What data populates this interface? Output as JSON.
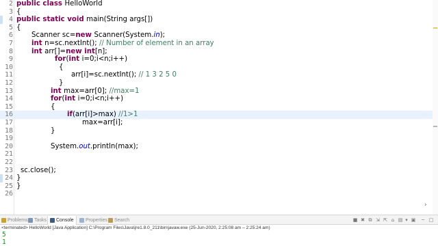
{
  "editor": {
    "current_line": "16",
    "lines": [
      {
        "num": "2",
        "indent": 0,
        "tokens": [
          [
            "kw",
            "public "
          ],
          [
            "kw",
            "class "
          ],
          [
            "",
            "HelloWorld"
          ]
        ]
      },
      {
        "num": "3",
        "indent": 0,
        "tokens": [
          [
            "",
            "{"
          ]
        ]
      },
      {
        "num": "4",
        "indent": 0,
        "tokens": [
          [
            "kw",
            "public "
          ],
          [
            "kw",
            "static "
          ],
          [
            "kw",
            "void "
          ],
          [
            "",
            "main(String args[])"
          ]
        ]
      },
      {
        "num": "5",
        "indent": 0,
        "tokens": [
          [
            "",
            "{"
          ]
        ]
      },
      {
        "num": "6",
        "indent": 22,
        "tokens": [
          [
            "",
            "Scanner sc="
          ],
          [
            "kw",
            "new "
          ],
          [
            "",
            "Scanner(System."
          ],
          [
            "it",
            "in"
          ],
          [
            "",
            ");"
          ]
        ]
      },
      {
        "num": "7",
        "indent": 22,
        "tokens": [
          [
            "kw",
            "int "
          ],
          [
            "",
            "n=sc.nextInt(); "
          ],
          [
            "cm",
            "// Number of element in an array"
          ]
        ]
      },
      {
        "num": "8",
        "indent": 22,
        "tokens": [
          [
            "kw",
            "int "
          ],
          [
            "",
            "arr[]="
          ],
          [
            "kw",
            "new "
          ],
          [
            "kw",
            "int"
          ],
          [
            "",
            "[n];"
          ]
        ]
      },
      {
        "num": "9",
        "indent": 56,
        "tokens": [
          [
            "kw",
            "for"
          ],
          [
            "",
            "("
          ],
          [
            "kw",
            "int "
          ],
          [
            "",
            "i=0;i<n;i++)"
          ]
        ]
      },
      {
        "num": "10",
        "indent": 62,
        "tokens": [
          [
            "",
            "{"
          ]
        ]
      },
      {
        "num": "11",
        "indent": 80,
        "tokens": [
          [
            "",
            "arr[i]=sc.nextInt(); "
          ],
          [
            "cm",
            "// 1 3 2 5 0"
          ]
        ]
      },
      {
        "num": "12",
        "indent": 62,
        "tokens": [
          [
            "",
            "}"
          ]
        ]
      },
      {
        "num": "13",
        "indent": 50,
        "tokens": [
          [
            "kw",
            "int "
          ],
          [
            "",
            "max=arr[0]; "
          ],
          [
            "cm",
            "//max=1"
          ]
        ]
      },
      {
        "num": "14",
        "indent": 50,
        "tokens": [
          [
            "kw",
            "for"
          ],
          [
            "",
            "("
          ],
          [
            "kw",
            "int "
          ],
          [
            "",
            "i=0;i<n;i++)"
          ]
        ]
      },
      {
        "num": "15",
        "indent": 50,
        "tokens": [
          [
            "",
            "{"
          ]
        ]
      },
      {
        "num": "16",
        "indent": 74,
        "tokens": [
          [
            "kw",
            "if"
          ],
          [
            "",
            "(arr[i]>max) "
          ],
          [
            "cm",
            "//1>1"
          ]
        ]
      },
      {
        "num": "17",
        "indent": 96,
        "tokens": [
          [
            "",
            "max=arr[i];"
          ]
        ]
      },
      {
        "num": "18",
        "indent": 50,
        "tokens": [
          [
            "",
            "}"
          ]
        ]
      },
      {
        "num": "19",
        "indent": 0,
        "tokens": []
      },
      {
        "num": "20",
        "indent": 50,
        "tokens": [
          [
            "",
            "System."
          ],
          [
            "it",
            "out"
          ],
          [
            "",
            ".println(max);"
          ]
        ]
      },
      {
        "num": "21",
        "indent": 0,
        "tokens": []
      },
      {
        "num": "22",
        "indent": 0,
        "tokens": []
      },
      {
        "num": "23",
        "indent": 6,
        "tokens": [
          [
            "",
            "sc.close();"
          ]
        ]
      },
      {
        "num": "24",
        "indent": 0,
        "tokens": [
          [
            "",
            "}"
          ]
        ]
      },
      {
        "num": "25",
        "indent": 0,
        "tokens": [
          [
            "",
            "}"
          ]
        ]
      },
      {
        "num": "26",
        "indent": 0,
        "tokens": []
      }
    ]
  },
  "panel": {
    "tabs": [
      {
        "label": "Problems",
        "icon_color": "#c9a23a",
        "active": false
      },
      {
        "label": "Tasks",
        "icon_color": "#7a93b8",
        "active": false
      },
      {
        "label": "Console",
        "icon_color": "#3d5a80",
        "active": true
      },
      {
        "label": "Properties",
        "icon_color": "#9fb4cc",
        "active": false
      },
      {
        "label": "Search",
        "icon_color": "#b89a5a",
        "active": false
      }
    ],
    "toolbar_icons": [
      "■",
      "✖",
      "⧉",
      "⇲",
      "⇱",
      "⌂",
      "▤",
      "▾",
      "▣",
      "─",
      "□"
    ]
  },
  "console": {
    "status": "<terminated> HelloWorld [Java Application] C:\\Program Files\\Java\\jre1.8.0_211\\bin\\javaw.exe  (25-Jun-2020, 2:25:08 am – 2:25:24 am)",
    "output": [
      "5",
      "1"
    ]
  },
  "colors": {
    "keyword": "#7f0055",
    "comment": "#3f7f5f",
    "static_field": "#0000c0",
    "console_output": "#1f8a2e",
    "current_line": "#e8f2fe"
  }
}
